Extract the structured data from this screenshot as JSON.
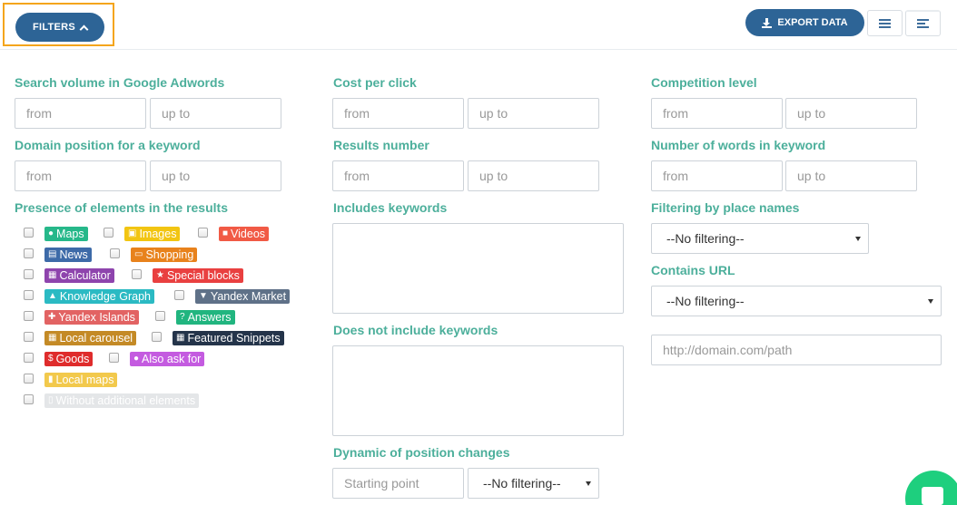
{
  "toolbar": {
    "filters_label": "FILTERS",
    "export_label": "EXPORT DATA"
  },
  "fields": {
    "search_volume": {
      "label": "Search volume in Google Adwords",
      "from": "from",
      "to": "up to"
    },
    "cost_per_click": {
      "label": "Cost per click",
      "from": "from",
      "to": "up to"
    },
    "competition": {
      "label": "Competition level",
      "from": "from",
      "to": "up to"
    },
    "domain_position": {
      "label": "Domain position for a keyword",
      "from": "from",
      "to": "up to"
    },
    "results_number": {
      "label": "Results number",
      "from": "from",
      "to": "up to"
    },
    "words_count": {
      "label": "Number of words in keyword",
      "from": "from",
      "to": "up to"
    },
    "presence_label": "Presence of elements in the results",
    "includes_label": "Includes keywords",
    "not_includes_label": "Does not include keywords",
    "dynamic_label": "Dynamic of position changes",
    "dynamic_start": "Starting point",
    "dynamic_select": "--No filtering--",
    "place_names_label": "Filtering by place names",
    "place_names_select": "--No filtering--",
    "contains_url_label": "Contains URL",
    "contains_url_select": "--No filtering--",
    "url_placeholder": "http://domain.com/path"
  },
  "elements": [
    {
      "label": "Maps",
      "color": "#26b88a",
      "icon": "map-marker-icon"
    },
    {
      "label": "Images",
      "color": "#f2c512",
      "icon": "image-icon"
    },
    {
      "label": "Videos",
      "color": "#f15a45",
      "icon": "video-icon"
    },
    {
      "label": "News",
      "color": "#3d6aa8",
      "icon": "newspaper-icon"
    },
    {
      "label": "Shopping",
      "color": "#e8821c",
      "icon": "money-icon"
    },
    {
      "label": "Calculator",
      "color": "#8e44ad",
      "icon": "calculator-icon"
    },
    {
      "label": "Special blocks",
      "color": "#e94040",
      "icon": "star-icon"
    },
    {
      "label": "Knowledge Graph",
      "color": "#2bbac3",
      "icon": "graduation-cap-icon"
    },
    {
      "label": "Yandex Market",
      "color": "#5f7188",
      "icon": "cart-icon"
    },
    {
      "label": "Yandex Islands",
      "color": "#e26363",
      "icon": "puzzle-icon"
    },
    {
      "label": "Answers",
      "color": "#21b57f",
      "icon": "question-icon"
    },
    {
      "label": "Local carousel",
      "color": "#c48a26",
      "icon": "grid-icon"
    },
    {
      "label": "Featured Snippets",
      "color": "#24344a",
      "icon": "table-icon"
    },
    {
      "label": "Goods",
      "color": "#df2c2c",
      "icon": "dollar-icon"
    },
    {
      "label": "Also ask for",
      "color": "#c45be0",
      "icon": "speech-bubble-icon"
    },
    {
      "label": "Local maps",
      "color": "#f2c94c",
      "icon": "folded-map-icon"
    },
    {
      "label": "Without additional elements",
      "color": "#e4e6e8",
      "icon": "file-icon"
    }
  ],
  "colors": {
    "accent": "#2d6496",
    "label": "#4caf9b",
    "highlight": "#f4a51c",
    "chat": "#1ecf7e"
  }
}
